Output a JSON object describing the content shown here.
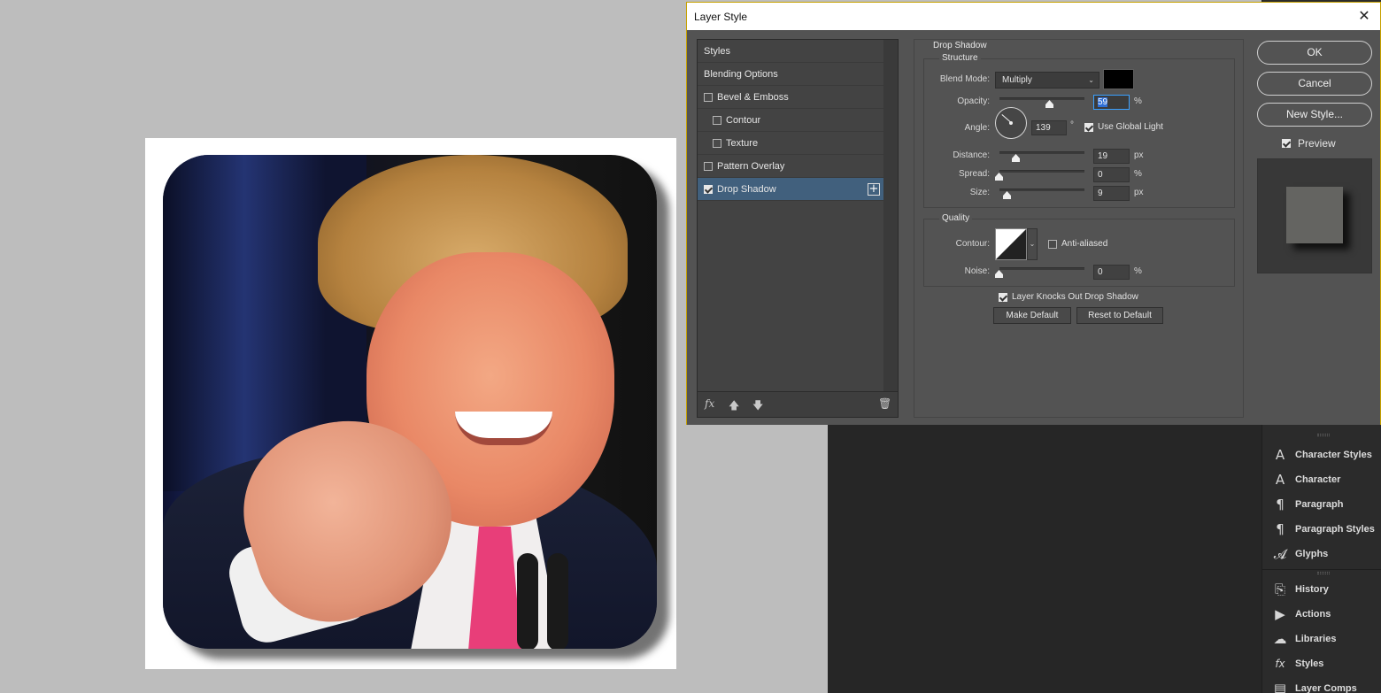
{
  "dialog": {
    "title": "Layer Style",
    "close_glyph": "✕",
    "styles_list": [
      {
        "label": "Styles",
        "type": "header"
      },
      {
        "label": "Blending Options",
        "type": "header"
      },
      {
        "label": "Bevel & Emboss",
        "type": "lvl1",
        "checked": false
      },
      {
        "label": "Contour",
        "type": "lvl2",
        "checked": false
      },
      {
        "label": "Texture",
        "type": "lvl2",
        "checked": false
      },
      {
        "label": "Pattern Overlay",
        "type": "lvl1",
        "checked": false
      },
      {
        "label": "Drop Shadow",
        "type": "lvl1",
        "checked": true,
        "selected": true,
        "add": "+"
      }
    ],
    "list_footer": {
      "fx": "fx",
      "up": "🡅",
      "down": "🡇",
      "trash": "🗑"
    },
    "drop_shadow": {
      "section_title": "Drop Shadow",
      "structure_title": "Structure",
      "blend_mode_label": "Blend Mode:",
      "blend_mode_value": "Multiply",
      "blend_color": "#000000",
      "opacity_label": "Opacity:",
      "opacity_value": "59",
      "opacity_unit": "%",
      "opacity_level": 0.59,
      "angle_label": "Angle:",
      "angle_value": "139",
      "angle_unit": "°",
      "use_global_light": "Use Global Light",
      "use_global_light_checked": true,
      "distance_label": "Distance:",
      "distance_value": "19",
      "distance_unit": "px",
      "spread_label": "Spread:",
      "spread_value": "0",
      "spread_unit": "%",
      "size_label": "Size:",
      "size_value": "9",
      "size_unit": "px",
      "quality_title": "Quality",
      "contour_label": "Contour:",
      "anti_aliased": "Anti-aliased",
      "anti_aliased_checked": false,
      "noise_label": "Noise:",
      "noise_value": "0",
      "noise_unit": "%",
      "knocks_out": "Layer Knocks Out Drop Shadow",
      "knocks_out_checked": true,
      "make_default": "Make Default",
      "reset_default": "Reset to Default"
    },
    "buttons": {
      "ok": "OK",
      "cancel": "Cancel",
      "new_style": "New Style...",
      "preview": "Preview",
      "preview_checked": true
    }
  },
  "right_panel": {
    "items": [
      {
        "label": "Character Styles",
        "icon": "character-styles-icon",
        "glyph": "A"
      },
      {
        "label": "Character",
        "icon": "character-icon",
        "glyph": "A"
      },
      {
        "label": "Paragraph",
        "icon": "paragraph-icon",
        "glyph": "¶"
      },
      {
        "label": "Paragraph Styles",
        "icon": "paragraph-styles-icon",
        "glyph": "¶"
      },
      {
        "label": "Glyphs",
        "icon": "glyphs-icon",
        "glyph": "𝓐"
      }
    ],
    "items2": [
      {
        "label": "History",
        "icon": "history-icon",
        "glyph": "⎘"
      },
      {
        "label": "Actions",
        "icon": "actions-icon",
        "glyph": "▶"
      },
      {
        "label": "Libraries",
        "icon": "libraries-icon",
        "glyph": "☁"
      },
      {
        "label": "Styles",
        "icon": "styles-icon",
        "glyph": "fx"
      },
      {
        "label": "Layer Comps",
        "icon": "layer-comps-icon",
        "glyph": "▤"
      }
    ]
  }
}
